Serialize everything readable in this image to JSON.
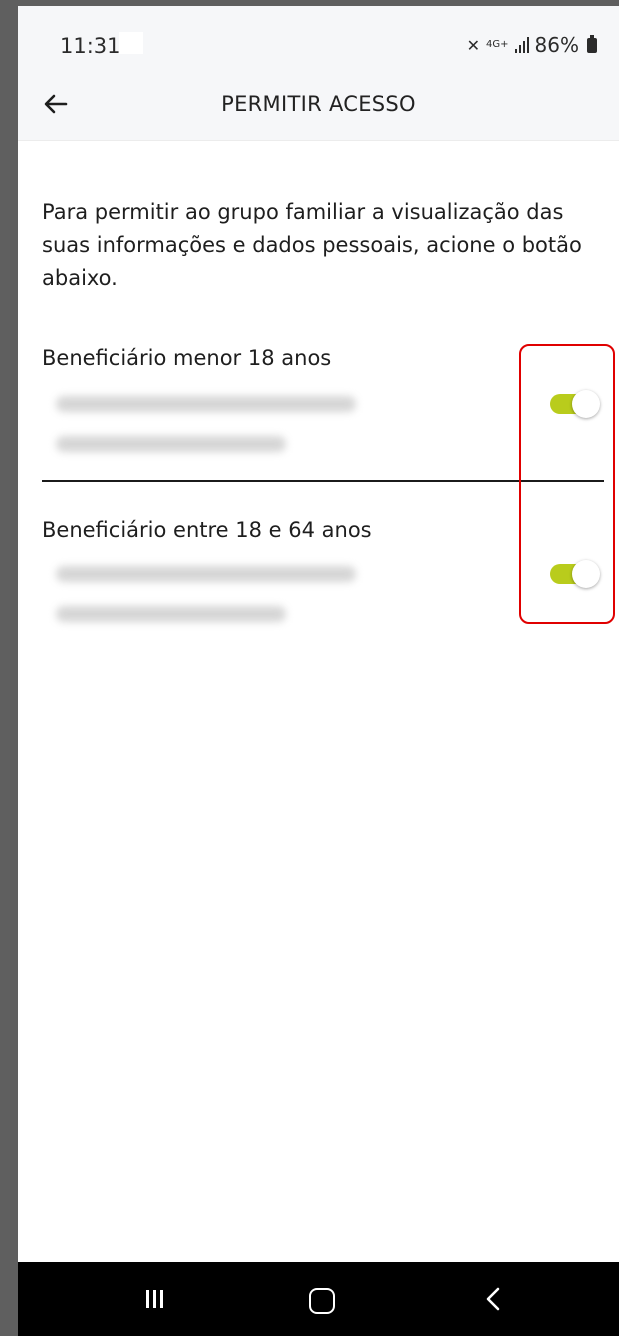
{
  "status_bar": {
    "time": "11:31",
    "network_label": "4G+",
    "battery_percent": "86%"
  },
  "app_bar": {
    "title": "PERMITIR ACESSO",
    "back_icon": "arrow-left-icon"
  },
  "intro_text": "Para permitir ao grupo familiar a visualização das suas informações e dados pessoais, acione o botão abaixo.",
  "beneficiaries": [
    {
      "category_label": "Beneficiário menor 18 anos",
      "access_enabled": true
    },
    {
      "category_label": "Beneficiário entre 18 e 64 anos",
      "access_enabled": true
    }
  ],
  "colors": {
    "toggle_on": "#b9cc1c",
    "highlight": "#e00000",
    "app_bar_bg": "#f6f7f9"
  },
  "nav_bar": {
    "icons": [
      "recents-icon",
      "home-icon",
      "back-nav-icon"
    ]
  }
}
